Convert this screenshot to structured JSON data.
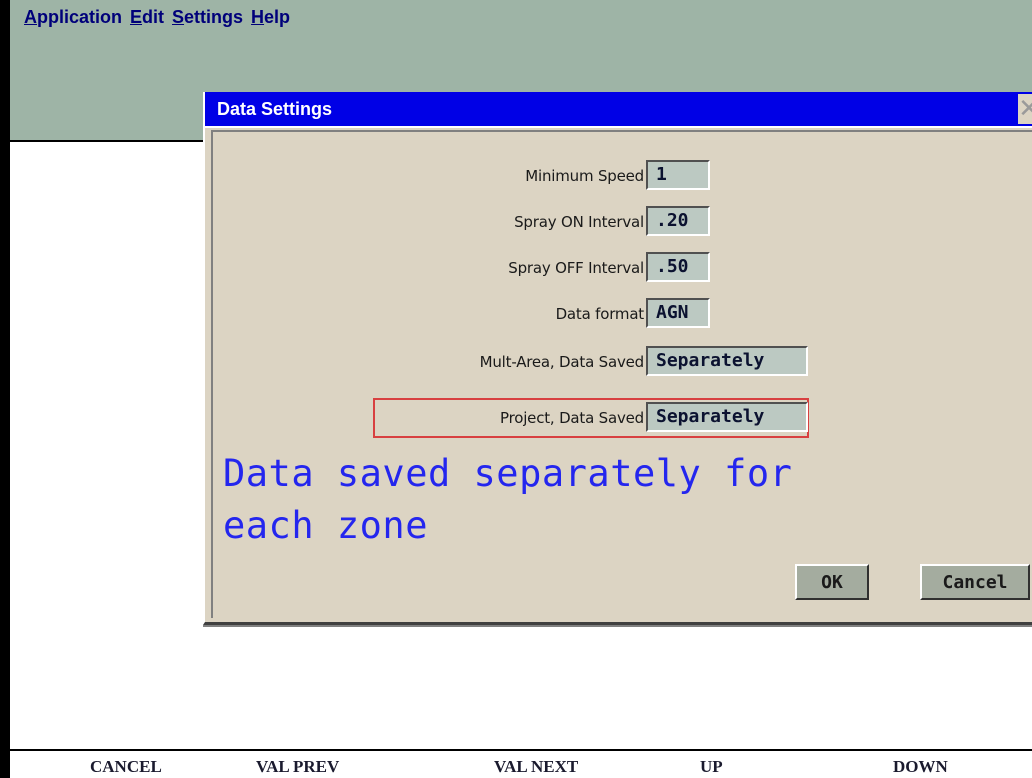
{
  "menubar": {
    "items": [
      {
        "mnemonic": "A",
        "rest": "pplication"
      },
      {
        "mnemonic": "E",
        "rest": "dit"
      },
      {
        "mnemonic": "S",
        "rest": "ettings"
      },
      {
        "mnemonic": "H",
        "rest": "elp"
      }
    ]
  },
  "dialog": {
    "title": "Data Settings",
    "close_icon": "close-x-icon",
    "fields": [
      {
        "label": "Minimum Speed",
        "value": "1"
      },
      {
        "label": "Spray ON Interval",
        "value": ".20"
      },
      {
        "label": "Spray OFF Interval",
        "value": ".50"
      },
      {
        "label": "Data format",
        "value": "AGN"
      },
      {
        "label": "Mult-Area, Data Saved",
        "value": "Separately"
      },
      {
        "label": "Project, Data Saved",
        "value": "Separately"
      }
    ],
    "info_line1": "Data saved separately for",
    "info_line2": "each zone",
    "ok_label": "OK",
    "cancel_label": "Cancel"
  },
  "function_keys": [
    "CANCEL",
    "VAL PREV",
    "VAL NEXT",
    "UP",
    "DOWN"
  ],
  "colors": {
    "titlebar": "#0000e6",
    "menubar": "#9eb4a6",
    "dialog_bg": "#dcd4c3",
    "info_text": "#2426ee",
    "highlight": "#d84040"
  }
}
